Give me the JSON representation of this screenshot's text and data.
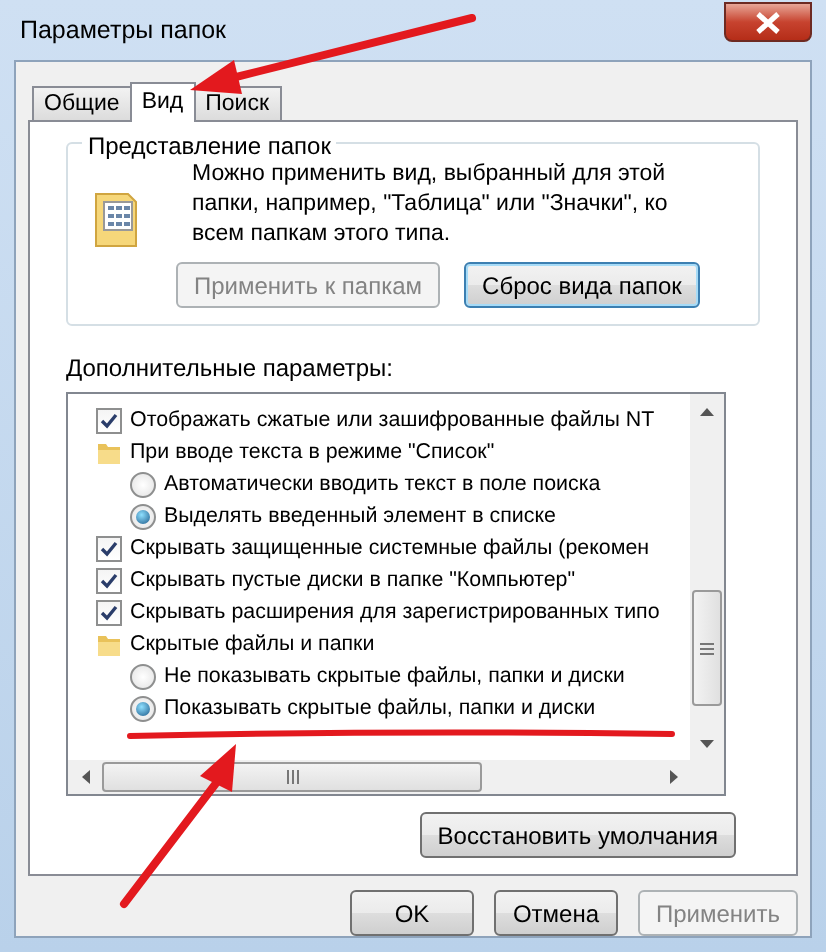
{
  "window": {
    "title": "Параметры папок"
  },
  "tabs": [
    {
      "label": "Общие",
      "selected": false
    },
    {
      "label": "Вид",
      "selected": true
    },
    {
      "label": "Поиск",
      "selected": false
    }
  ],
  "folder_views": {
    "title": "Представление папок",
    "description": "Можно применить вид, выбранный для этой папки, например, \"Таблица\" или \"Значки\", ко всем папкам этого типа.",
    "buttons": [
      {
        "label": "Применить к папкам",
        "disabled": true
      },
      {
        "label": "Сброс вида папок",
        "disabled": false
      }
    ]
  },
  "advanced": {
    "label": "Дополнительные параметры:",
    "items": [
      {
        "kind": "checkbox",
        "label": "Отображать сжатые или зашифрованные файлы NT",
        "checked": true
      },
      {
        "kind": "folder",
        "label": "При вводе текста в режиме \"Список\"",
        "children": [
          {
            "kind": "radio",
            "label": "Автоматически вводить текст в поле поиска",
            "selected": false
          },
          {
            "kind": "radio",
            "label": "Выделять введенный элемент в списке",
            "selected": true
          }
        ]
      },
      {
        "kind": "checkbox",
        "label": "Скрывать защищенные системные файлы (рекомен",
        "checked": true
      },
      {
        "kind": "checkbox",
        "label": "Скрывать пустые диски в папке \"Компьютер\"",
        "checked": true
      },
      {
        "kind": "checkbox",
        "label": "Скрывать расширения для зарегистрированных типо",
        "checked": true
      },
      {
        "kind": "folder",
        "label": "Скрытые файлы и папки",
        "children": [
          {
            "kind": "radio",
            "label": "Не показывать скрытые файлы, папки и диски",
            "selected": false
          },
          {
            "kind": "radio",
            "label": "Показывать скрытые файлы, папки и диски",
            "selected": true
          }
        ]
      }
    ]
  },
  "restore_button": {
    "label": "Восстановить умолчания"
  },
  "dialog_buttons": [
    {
      "label": "OK",
      "disabled": false
    },
    {
      "label": "Отмена",
      "disabled": false
    },
    {
      "label": "Применить",
      "disabled": true
    }
  ]
}
